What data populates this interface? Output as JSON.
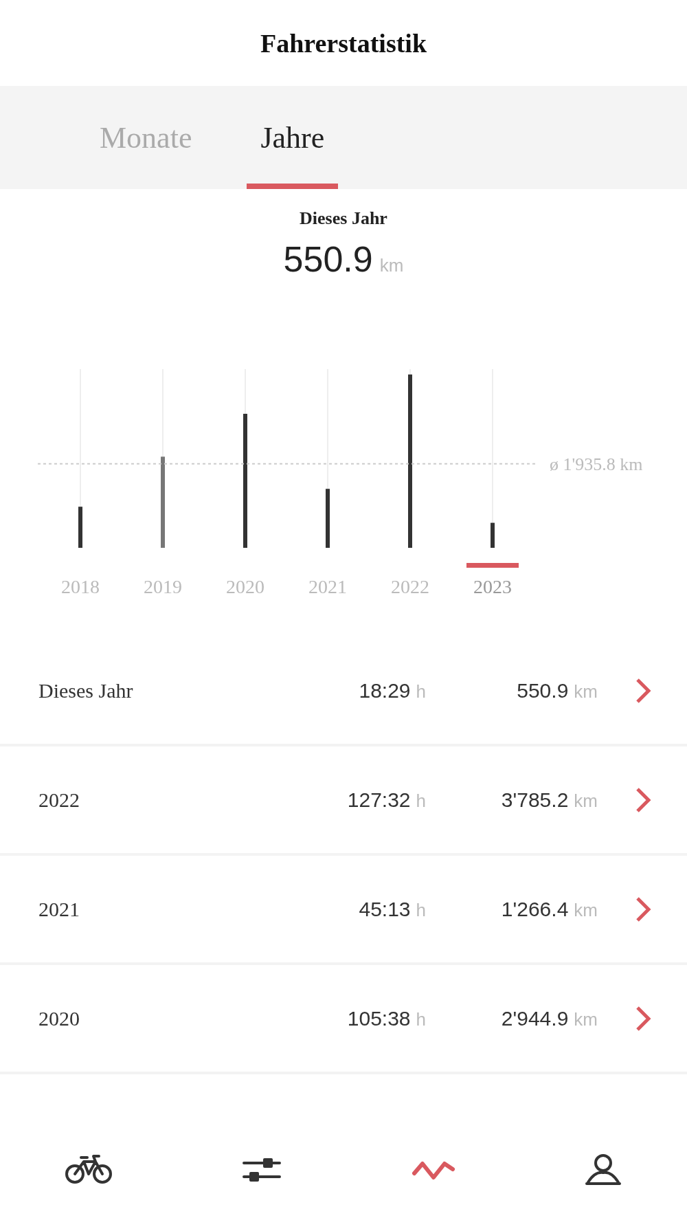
{
  "header": {
    "title": "Fahrerstatistik"
  },
  "tabs": [
    {
      "label": "Monate",
      "selected": false
    },
    {
      "label": "Jahre",
      "selected": true
    }
  ],
  "summary": {
    "label": "Dieses Jahr",
    "value": "550.9",
    "unit": "km"
  },
  "chart": {
    "average_label": "ø 1'935.8 km",
    "years": [
      {
        "label": "2018",
        "selected": false
      },
      {
        "label": "2019",
        "selected": false
      },
      {
        "label": "2020",
        "selected": false
      },
      {
        "label": "2021",
        "selected": false
      },
      {
        "label": "2022",
        "selected": false
      },
      {
        "label": "2023",
        "selected": true
      }
    ]
  },
  "rows": [
    {
      "label": "Dieses Jahr",
      "time": "18:29",
      "time_unit": "h",
      "distance": "550.9",
      "distance_unit": "km"
    },
    {
      "label": "2022",
      "time": "127:32",
      "time_unit": "h",
      "distance": "3'785.2",
      "distance_unit": "km"
    },
    {
      "label": "2021",
      "time": "45:13",
      "time_unit": "h",
      "distance": "1'266.4",
      "distance_unit": "km"
    },
    {
      "label": "2020",
      "time": "105:38",
      "time_unit": "h",
      "distance": "2'944.9",
      "distance_unit": "km"
    }
  ],
  "nav": [
    {
      "kind": "bike",
      "selected": false
    },
    {
      "kind": "sliders",
      "selected": false
    },
    {
      "kind": "stats",
      "selected": true
    },
    {
      "kind": "profile",
      "selected": false
    }
  ]
}
